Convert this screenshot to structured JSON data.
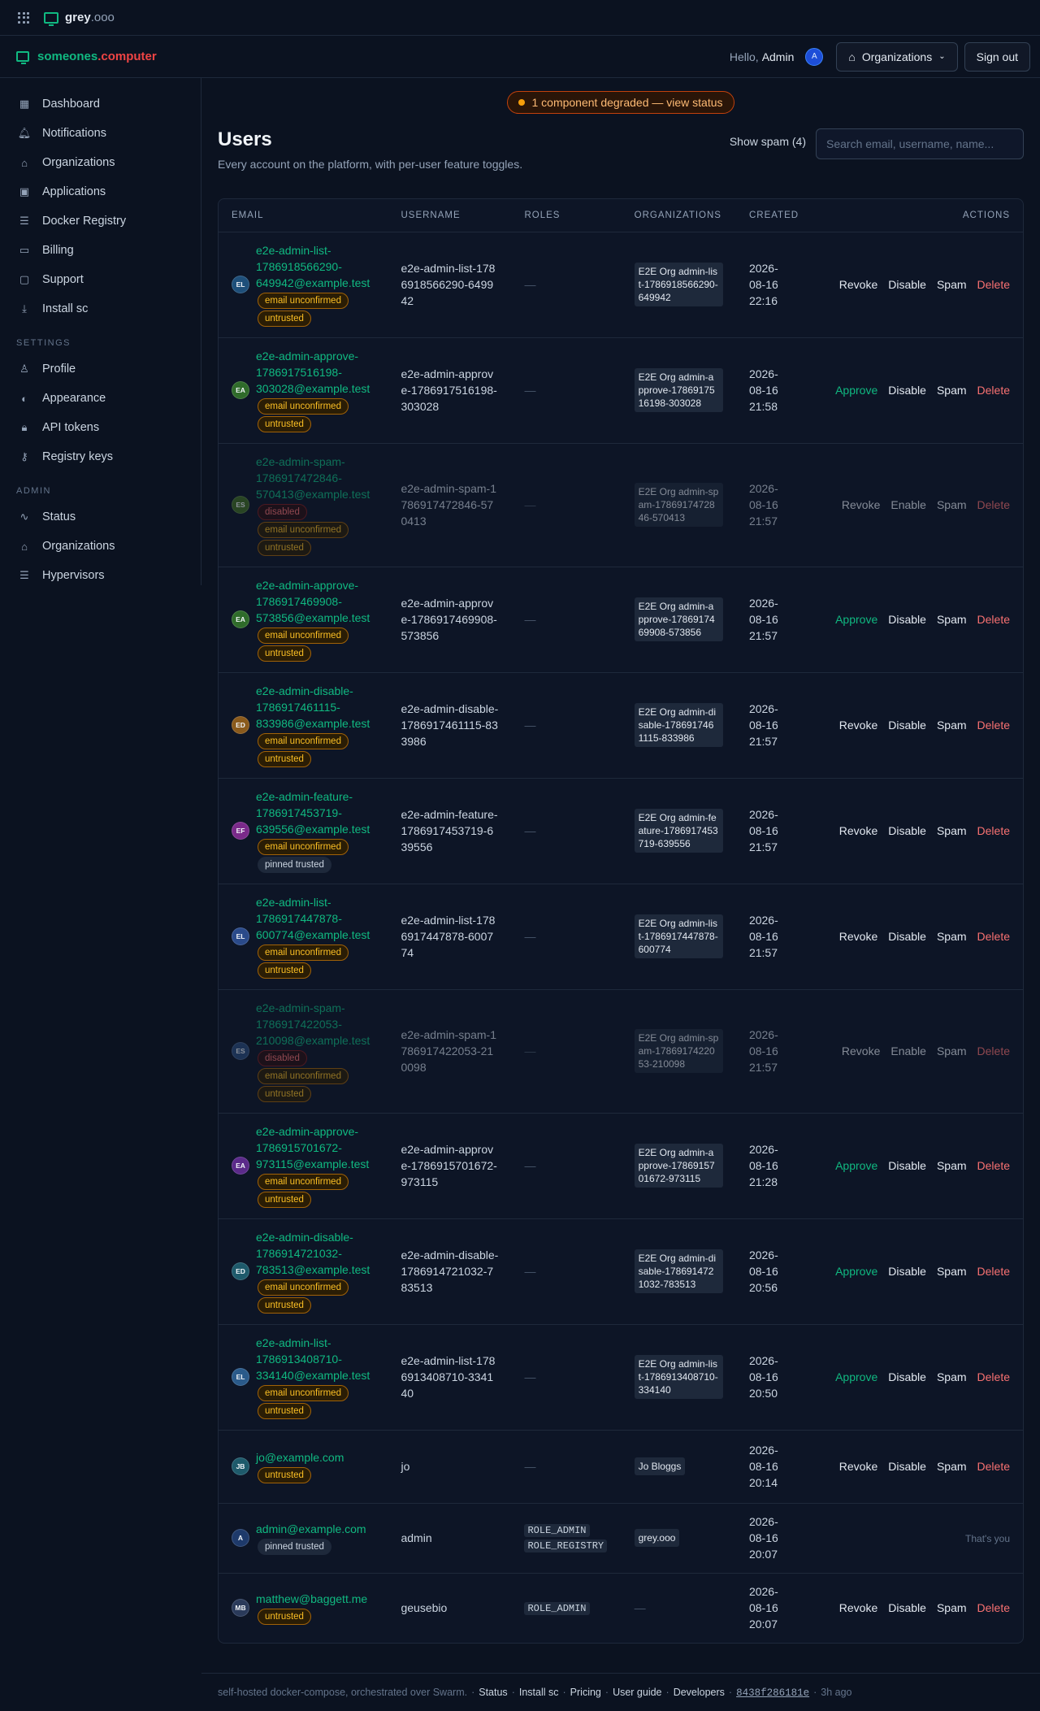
{
  "topbar": {
    "brand": "grey",
    "brand_tld": ".ooo"
  },
  "header": {
    "brand_name": "someones",
    "brand_dot": ".",
    "brand_tld": "computer",
    "hello": "Hello,",
    "user": "Admin",
    "avatar": "A",
    "org_button": "Organizations",
    "sign_out": "Sign out"
  },
  "sidebar": {
    "main": [
      {
        "label": "Dashboard",
        "icon": "dashboard-icon",
        "glyph": "▦"
      },
      {
        "label": "Notifications",
        "icon": "bell-icon",
        "glyph": "🔔︎"
      },
      {
        "label": "Organizations",
        "icon": "building-icon",
        "glyph": "⌂"
      },
      {
        "label": "Applications",
        "icon": "app-window-icon",
        "glyph": "▣"
      },
      {
        "label": "Docker Registry",
        "icon": "server-icon",
        "glyph": "☰"
      },
      {
        "label": "Billing",
        "icon": "credit-card-icon",
        "glyph": "▭"
      },
      {
        "label": "Support",
        "icon": "chat-icon",
        "glyph": "▢"
      },
      {
        "label": "Install sc",
        "icon": "download-icon",
        "glyph": "⤓"
      }
    ],
    "settings_heading": "SETTINGS",
    "settings": [
      {
        "label": "Profile",
        "icon": "user-icon",
        "glyph": "♙"
      },
      {
        "label": "Appearance",
        "icon": "palette-icon",
        "glyph": "◐"
      },
      {
        "label": "API tokens",
        "icon": "lock-icon",
        "glyph": "🔒︎"
      },
      {
        "label": "Registry keys",
        "icon": "key-icon",
        "glyph": "⚷"
      }
    ],
    "admin_heading": "ADMIN",
    "admin": [
      {
        "label": "Status",
        "icon": "activity-icon",
        "glyph": "∿"
      },
      {
        "label": "Organizations",
        "icon": "building-icon",
        "glyph": "⌂"
      },
      {
        "label": "Hypervisors",
        "icon": "server-icon",
        "glyph": "☰"
      }
    ]
  },
  "banner": "1 component degraded — view status",
  "page": {
    "title": "Users",
    "subtitle": "Every account on the platform, with per-user feature toggles.",
    "show_spam": "Show spam (4)",
    "search_placeholder": "Search email, username, name..."
  },
  "table": {
    "headers": {
      "email": "EMAIL",
      "username": "USERNAME",
      "roles": "ROLES",
      "organizations": "ORGANIZATIONS",
      "created": "CREATED",
      "actions": "ACTIONS"
    },
    "rows": [
      {
        "initials": "EL",
        "color": "#1e4f7a",
        "email": "e2e-admin-list-1786918566290-649942@example.test",
        "badges": [
          {
            "text": "email unconfirmed",
            "kind": "amber"
          },
          {
            "text": "untrusted",
            "kind": "amber"
          }
        ],
        "username": "e2e-admin-list-1786918566290-649942",
        "roles": [],
        "org": "E2E Org admin-list-1786918566290-649942",
        "created": "2026-08-16 22:16",
        "actions": [
          "Revoke",
          "Disable",
          "Spam",
          "Delete"
        ],
        "faded": false
      },
      {
        "initials": "EA",
        "color": "#2f6b2a",
        "email": "e2e-admin-approve-1786917516198-303028@example.test",
        "badges": [
          {
            "text": "email unconfirmed",
            "kind": "amber"
          },
          {
            "text": "untrusted",
            "kind": "amber"
          }
        ],
        "username": "e2e-admin-approve-1786917516198-303028",
        "roles": [],
        "org": "E2E Org admin-approve-1786917516198-303028",
        "created": "2026-08-16 21:58",
        "actions": [
          "Approve",
          "Disable",
          "Spam",
          "Delete"
        ],
        "faded": false
      },
      {
        "initials": "ES",
        "color": "#3f6b22",
        "email": "e2e-admin-spam-1786917472846-570413@example.test",
        "badges": [
          {
            "text": "disabled",
            "kind": "red"
          },
          {
            "text": "email unconfirmed",
            "kind": "amber"
          },
          {
            "text": "untrusted",
            "kind": "amber"
          }
        ],
        "username": "e2e-admin-spam-1786917472846-570413",
        "roles": [],
        "org": "E2E Org admin-spam-1786917472846-570413",
        "created": "2026-08-16 21:57",
        "actions": [
          "Revoke",
          "Enable",
          "Spam",
          "Delete"
        ],
        "faded": true
      },
      {
        "initials": "EA",
        "color": "#2f6b2a",
        "email": "e2e-admin-approve-1786917469908-573856@example.test",
        "badges": [
          {
            "text": "email unconfirmed",
            "kind": "amber"
          },
          {
            "text": "untrusted",
            "kind": "amber"
          }
        ],
        "username": "e2e-admin-approve-1786917469908-573856",
        "roles": [],
        "org": "E2E Org admin-approve-1786917469908-573856",
        "created": "2026-08-16 21:57",
        "actions": [
          "Approve",
          "Disable",
          "Spam",
          "Delete"
        ],
        "faded": false
      },
      {
        "initials": "ED",
        "color": "#8a5a1c",
        "email": "e2e-admin-disable-1786917461115-833986@example.test",
        "badges": [
          {
            "text": "email unconfirmed",
            "kind": "amber"
          },
          {
            "text": "untrusted",
            "kind": "amber"
          }
        ],
        "username": "e2e-admin-disable-1786917461115-833986",
        "roles": [],
        "org": "E2E Org admin-disable-1786917461115-833986",
        "created": "2026-08-16 21:57",
        "actions": [
          "Revoke",
          "Disable",
          "Spam",
          "Delete"
        ],
        "faded": false
      },
      {
        "initials": "EF",
        "color": "#7a2a8a",
        "email": "e2e-admin-feature-1786917453719-639556@example.test",
        "badges": [
          {
            "text": "email unconfirmed",
            "kind": "amber"
          },
          {
            "text": "pinned trusted",
            "kind": "gray"
          }
        ],
        "username": "e2e-admin-feature-1786917453719-639556",
        "roles": [],
        "org": "E2E Org admin-feature-1786917453719-639556",
        "created": "2026-08-16 21:57",
        "actions": [
          "Revoke",
          "Disable",
          "Spam",
          "Delete"
        ],
        "faded": false
      },
      {
        "initials": "EL",
        "color": "#2a4a8a",
        "email": "e2e-admin-list-1786917447878-600774@example.test",
        "badges": [
          {
            "text": "email unconfirmed",
            "kind": "amber"
          },
          {
            "text": "untrusted",
            "kind": "amber"
          }
        ],
        "username": "e2e-admin-list-1786917447878-600774",
        "roles": [],
        "org": "E2E Org admin-list-1786917447878-600774",
        "created": "2026-08-16 21:57",
        "actions": [
          "Revoke",
          "Disable",
          "Spam",
          "Delete"
        ],
        "faded": false
      },
      {
        "initials": "ES",
        "color": "#2a4a7a",
        "email": "e2e-admin-spam-1786917422053-210098@example.test",
        "badges": [
          {
            "text": "disabled",
            "kind": "red"
          },
          {
            "text": "email unconfirmed",
            "kind": "amber"
          },
          {
            "text": "untrusted",
            "kind": "amber"
          }
        ],
        "username": "e2e-admin-spam-1786917422053-210098",
        "roles": [],
        "org": "E2E Org admin-spam-1786917422053-210098",
        "created": "2026-08-16 21:57",
        "actions": [
          "Revoke",
          "Enable",
          "Spam",
          "Delete"
        ],
        "faded": true
      },
      {
        "initials": "EA",
        "color": "#5b2a8a",
        "email": "e2e-admin-approve-1786915701672-973115@example.test",
        "badges": [
          {
            "text": "email unconfirmed",
            "kind": "amber"
          },
          {
            "text": "untrusted",
            "kind": "amber"
          }
        ],
        "username": "e2e-admin-approve-1786915701672-973115",
        "roles": [],
        "org": "E2E Org admin-approve-1786915701672-973115",
        "created": "2026-08-16 21:28",
        "actions": [
          "Approve",
          "Disable",
          "Spam",
          "Delete"
        ],
        "faded": false
      },
      {
        "initials": "ED",
        "color": "#1e5a6b",
        "email": "e2e-admin-disable-1786914721032-783513@example.test",
        "badges": [
          {
            "text": "email unconfirmed",
            "kind": "amber"
          },
          {
            "text": "untrusted",
            "kind": "amber"
          }
        ],
        "username": "e2e-admin-disable-1786914721032-783513",
        "roles": [],
        "org": "E2E Org admin-disable-1786914721032-783513",
        "created": "2026-08-16 20:56",
        "actions": [
          "Approve",
          "Disable",
          "Spam",
          "Delete"
        ],
        "faded": false
      },
      {
        "initials": "EL",
        "color": "#2a5a8a",
        "email": "e2e-admin-list-1786913408710-334140@example.test",
        "badges": [
          {
            "text": "email unconfirmed",
            "kind": "amber"
          },
          {
            "text": "untrusted",
            "kind": "amber"
          }
        ],
        "username": "e2e-admin-list-1786913408710-334140",
        "roles": [],
        "org": "E2E Org admin-list-1786913408710-334140",
        "created": "2026-08-16 20:50",
        "actions": [
          "Approve",
          "Disable",
          "Spam",
          "Delete"
        ],
        "faded": false
      },
      {
        "initials": "JB",
        "color": "#1e5a6b",
        "email": "jo@example.com",
        "badges": [
          {
            "text": "untrusted",
            "kind": "amber"
          }
        ],
        "username": "jo",
        "roles": [],
        "org": "Jo Bloggs",
        "created": "2026-08-16 20:14",
        "actions": [
          "Revoke",
          "Disable",
          "Spam",
          "Delete"
        ],
        "faded": false
      },
      {
        "initials": "A",
        "color": "#1e3a6b",
        "email": "admin@example.com",
        "badges": [
          {
            "text": "pinned trusted",
            "kind": "gray"
          }
        ],
        "username": "admin",
        "roles": [
          "ROLE_ADMIN",
          "ROLE_REGISTRY"
        ],
        "org": "grey.ooo",
        "created": "2026-08-16 20:07",
        "actions": [],
        "note": "That's you",
        "faded": false
      },
      {
        "initials": "MB",
        "color": "#2a3a5a",
        "email": "matthew@baggett.me",
        "badges": [
          {
            "text": "untrusted",
            "kind": "amber"
          }
        ],
        "username": "geusebio",
        "roles": [
          "ROLE_ADMIN"
        ],
        "org": "",
        "created": "2026-08-16 20:07",
        "actions": [
          "Revoke",
          "Disable",
          "Spam",
          "Delete"
        ],
        "faded": false
      }
    ]
  },
  "footer": {
    "text": "self-hosted docker-compose, orchestrated over Swarm.",
    "sep": "·",
    "links": [
      "Status",
      "Install sc",
      "Pricing",
      "User guide",
      "Developers"
    ],
    "hash": "8438f286181e",
    "ago": "3h ago"
  }
}
